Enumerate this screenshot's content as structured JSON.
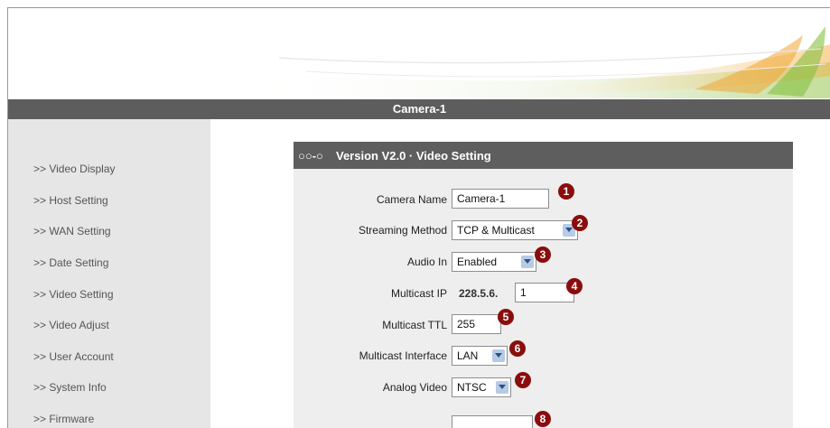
{
  "header": {
    "title": "Camera-1"
  },
  "sidebar": {
    "items": [
      {
        "label": ">> Video Display"
      },
      {
        "label": ">> Host Setting"
      },
      {
        "label": ">> WAN Setting"
      },
      {
        "label": ">> Date Setting"
      },
      {
        "label": ">> Video Setting"
      },
      {
        "label": ">> Video Adjust"
      },
      {
        "label": ">> User Account"
      },
      {
        "label": ">> System Info"
      },
      {
        "label": ">> Firmware"
      }
    ]
  },
  "panel": {
    "chain_icon": "○○-○",
    "title": "Version V2.0 · Video Setting",
    "fields": {
      "camera_name": {
        "label": "Camera Name",
        "value": "Camera-1",
        "badge": "1"
      },
      "streaming_method": {
        "label": "Streaming Method",
        "value": "TCP & Multicast",
        "badge": "2"
      },
      "audio_in": {
        "label": "Audio In",
        "value": "Enabled",
        "badge": "3"
      },
      "multicast_ip": {
        "label": "Multicast IP",
        "prefix": "228.5.6.",
        "value": "1",
        "badge": "4"
      },
      "multicast_ttl": {
        "label": "Multicast TTL",
        "value": "255",
        "badge": "5"
      },
      "multicast_interface": {
        "label": "Multicast Interface",
        "value": "LAN",
        "badge": "6"
      },
      "analog_video": {
        "label": "Analog Video",
        "value": "NTSC",
        "badge": "7"
      },
      "partial_row": {
        "badge": "8"
      }
    }
  },
  "colors": {
    "title_bar": "#5d5d5d",
    "sidebar": "#e6e6e6",
    "panel": "#eeeeee",
    "badge": "#8a0d0d",
    "select_arrow": "#b6cbe5"
  }
}
